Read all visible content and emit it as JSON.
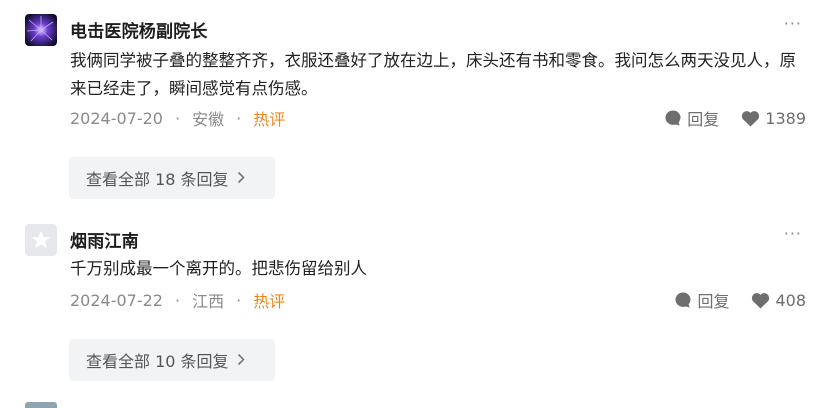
{
  "comments": [
    {
      "username": "电击医院杨副院长",
      "text": "我俩同学被子叠的整整齐齐，衣服还叠好了放在边上，床头还有书和零食。我问怎么两天没见人，原来已经走了，瞬间感觉有点伤感。",
      "date": "2024-07-20",
      "location": "安徽",
      "hot_label": "热评",
      "reply_label": "回复",
      "likes": "1389",
      "view_all": "查看全部 18 条回复",
      "more": "···"
    },
    {
      "username": "烟雨江南",
      "text": "千万别成最一个离开的。把悲伤留给别人",
      "date": "2024-07-22",
      "location": "江西",
      "hot_label": "热评",
      "reply_label": "回复",
      "likes": "408",
      "view_all": "查看全部 10 条回复",
      "more": "···"
    }
  ],
  "colors": {
    "hot": "#f0861a",
    "meta": "#8a8a8a",
    "button_bg": "#f2f3f5"
  },
  "icons": {
    "reply": "comment-bubble-icon",
    "like": "heart-icon",
    "chevron": "chevron-right-icon",
    "more": "more-dots-icon"
  }
}
